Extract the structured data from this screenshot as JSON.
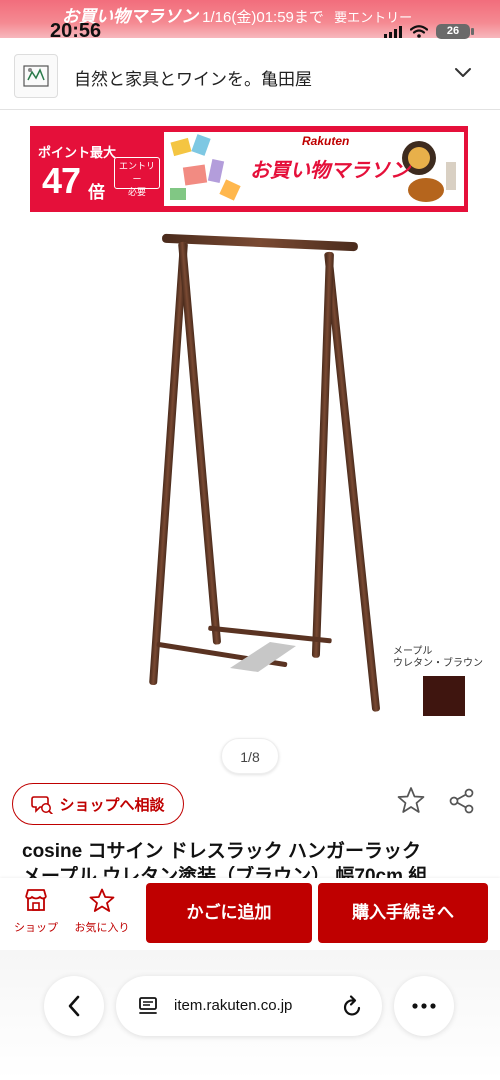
{
  "promo": {
    "campaign": "お買い物マラソン",
    "deadline": "1/16(金)01:59まで",
    "entry": "要エントリー"
  },
  "status_bar": {
    "time": "20:56",
    "battery": "26"
  },
  "shop": {
    "name": "自然と家具とワインを。亀田屋"
  },
  "banner": {
    "points_label": "ポイント最大",
    "points_value": "47",
    "points_unit": "倍",
    "entry_line1": "エントリー",
    "entry_line2": "必要",
    "brand": "Rakuten",
    "title": "お買い物マラソン"
  },
  "product": {
    "swatch_name_line1": "メープル",
    "swatch_name_line2": "ウレタン・ブラウン",
    "swatch_color": "#3f150f",
    "image_counter": "1/8",
    "title_line1": "cosine コサイン ドレスラック ハンガーラック",
    "title_line2": "メープル ウレタン塗装（ブラウン） 幅70cm 組"
  },
  "actions": {
    "consult_label": "ショップへ相談",
    "shop_label": "ショップ",
    "favorite_label": "お気に入り",
    "cart_label": "かごに追加",
    "buy_label": "購入手続きへ"
  },
  "browser": {
    "url": "item.rakuten.co.jp"
  },
  "colors": {
    "rakuten_red": "#bf0000",
    "banner_red": "#e5103a",
    "promo_pink": "#f26d7c"
  }
}
